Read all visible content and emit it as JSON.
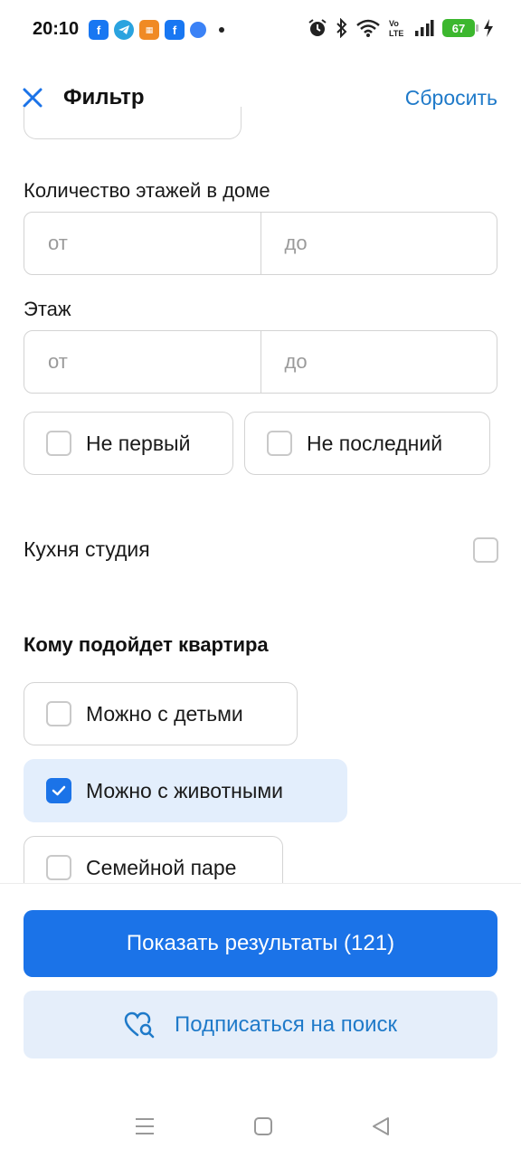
{
  "status_bar": {
    "time": "20:10",
    "battery": "67",
    "icons": [
      "alarm-icon",
      "bluetooth-icon",
      "wifi-icon",
      "volte-icon",
      "signal-icon",
      "charging-icon"
    ]
  },
  "header": {
    "title": "Фильтр",
    "reset": "Сбросить"
  },
  "floors_in_building": {
    "label": "Количество этажей в доме",
    "from_placeholder": "от",
    "to_placeholder": "до"
  },
  "floor": {
    "label": "Этаж",
    "from_placeholder": "от",
    "to_placeholder": "до",
    "not_first": "Не первый",
    "not_last": "Не последний"
  },
  "kitchen_studio": {
    "label": "Кухня студия",
    "checked": false
  },
  "suitable_for": {
    "heading": "Кому подойдет квартира",
    "options": [
      {
        "label": "Можно с детьми",
        "checked": false
      },
      {
        "label": "Можно с животными",
        "checked": true
      },
      {
        "label": "Семейной паре",
        "checked": false
      }
    ]
  },
  "actions": {
    "show_results": "Показать результаты (121)",
    "subscribe": "Подписаться на поиск"
  },
  "colors": {
    "accent": "#1b73e8",
    "link": "#1f7ac9",
    "selected_chip_bg": "#e3eefc",
    "secondary_btn_bg": "#e5eefa"
  }
}
